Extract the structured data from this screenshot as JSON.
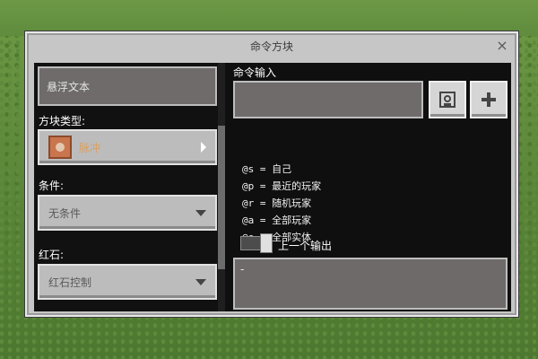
{
  "dialog": {
    "title": "命令方块",
    "close_glyph": "×"
  },
  "left": {
    "hover_text_value": "悬浮文本",
    "block_type_label": "方块类型:",
    "block_type_value": "脉冲",
    "condition_label": "条件:",
    "condition_value": "无条件",
    "redstone_label": "红石:",
    "redstone_value": "红石控制"
  },
  "right": {
    "command_input_label": "命令输入",
    "command_input_value": "",
    "help_lines": [
      "@s = 自己",
      "@p = 最近的玩家",
      "@r = 随机玩家",
      "@a = 全部玩家",
      "@e = 全部实体"
    ],
    "previous_output_label": "上一个输出",
    "previous_output_value": "-",
    "previous_output_enabled": true
  },
  "icons": [
    "close-icon",
    "block-icon",
    "arrow-right-icon",
    "chevron-down-icon",
    "save-icon",
    "plus-icon"
  ]
}
